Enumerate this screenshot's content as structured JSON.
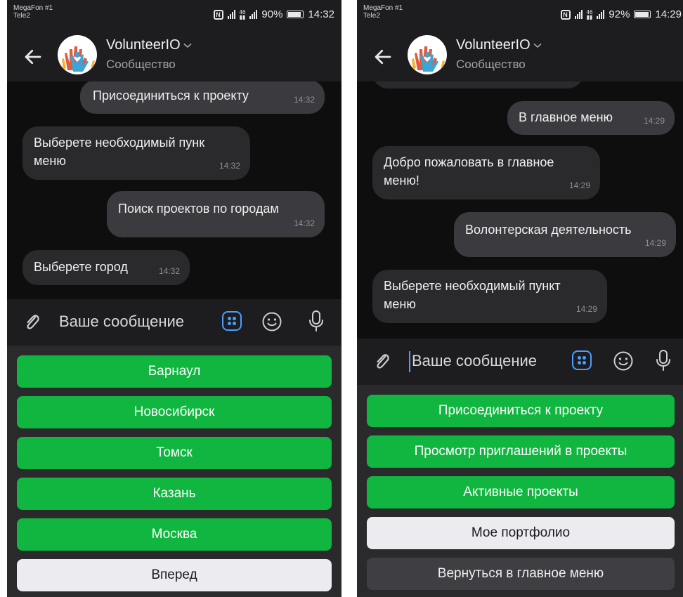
{
  "colors": {
    "accent_green": "#10b63f",
    "accent_blue": "#4a9eff",
    "background": "#0e0e0f",
    "bar": "#1d1d1f"
  },
  "screens": [
    {
      "status": {
        "carrier1": "MegaFon #1",
        "carrier2": "Tele2",
        "battery": "90%",
        "battery_level": 0.9,
        "time": "14:32"
      },
      "header": {
        "title": "VolunteerIO",
        "subtitle": "Сообщество"
      },
      "messages": [
        {
          "text": "Присоединиться к проекту",
          "time": "14:32",
          "outgoing": true
        },
        {
          "text": "Выберете необходимый пунк\nменю",
          "time": "14:32",
          "outgoing": false
        },
        {
          "text": "Поиск проектов по городам",
          "time": "14:32",
          "outgoing": true
        },
        {
          "text": "Выберете город",
          "time": "14:32",
          "outgoing": false
        }
      ],
      "composer": {
        "placeholder": "Ваше сообщение"
      },
      "keyboard": [
        {
          "label": "Барнаул",
          "style": "green"
        },
        {
          "label": "Новосибирск",
          "style": "green"
        },
        {
          "label": "Томск",
          "style": "green"
        },
        {
          "label": "Казань",
          "style": "green"
        },
        {
          "label": "Москва",
          "style": "green"
        },
        {
          "label": "Вперед",
          "style": "white"
        }
      ]
    },
    {
      "status": {
        "carrier1": "MegaFon #1",
        "carrier2": "Tele2",
        "battery": "92%",
        "battery_level": 0.92,
        "time": "14:29"
      },
      "header": {
        "title": "VolunteerIO",
        "subtitle": "Сообщество"
      },
      "messages": [
        {
          "text": "В главное меню",
          "time": "14:29",
          "outgoing": true
        },
        {
          "text": "Добро пожаловать в главное\nменю!",
          "time": "14:29",
          "outgoing": false
        },
        {
          "text": "Волонтерская деятельность",
          "time": "14:29",
          "outgoing": true
        },
        {
          "text": "Выберете необходимый пункт\nменю",
          "time": "14:29",
          "outgoing": false
        }
      ],
      "composer": {
        "placeholder": "Ваше сообщение"
      },
      "keyboard": [
        {
          "label": "Присоединиться к проекту",
          "style": "green"
        },
        {
          "label": "Просмотр приглашений в проекты",
          "style": "green"
        },
        {
          "label": "Активные проекты",
          "style": "green"
        },
        {
          "label": "Мое портфолио",
          "style": "white"
        },
        {
          "label": "Вернуться в главное меню",
          "style": "dark"
        }
      ]
    }
  ]
}
